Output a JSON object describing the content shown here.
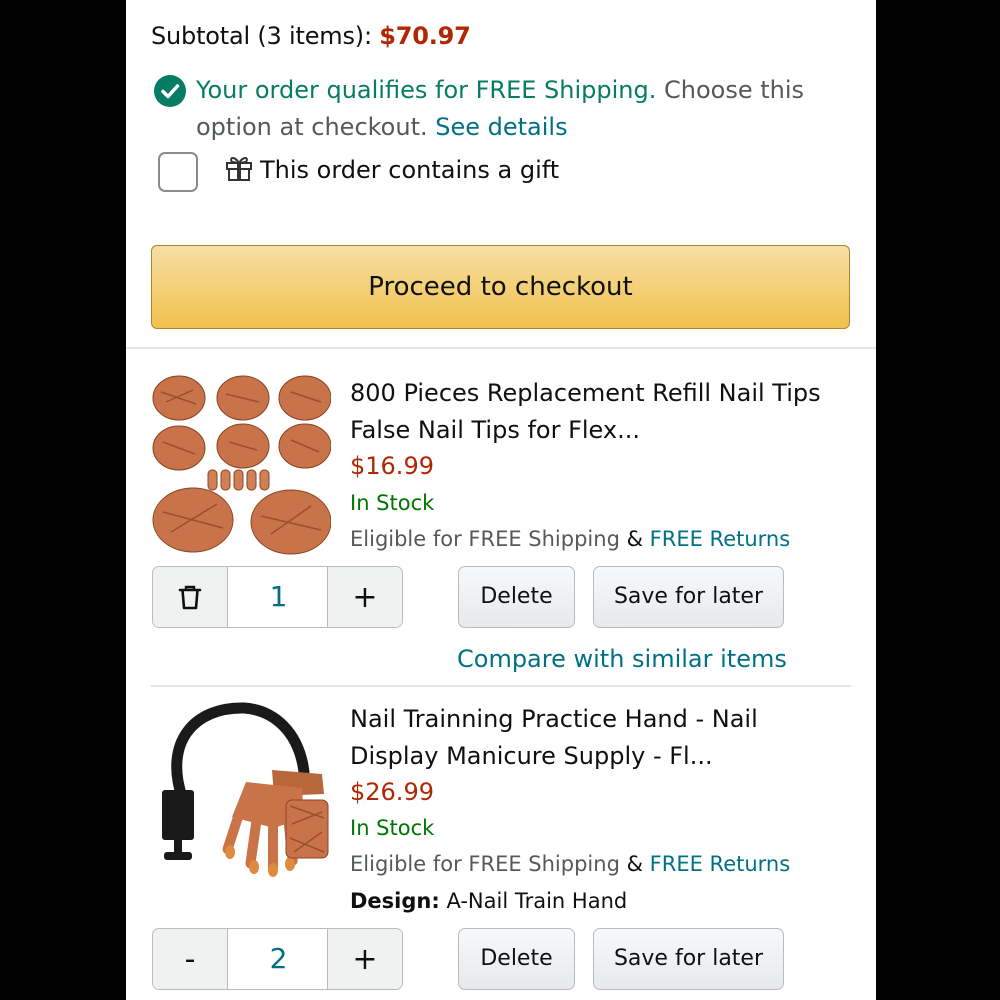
{
  "cart": {
    "subtotal_label": "Subtotal (3 items):",
    "subtotal_value": "$70.97",
    "free_shipping_green": "Your order qualifies for FREE Shipping.",
    "free_shipping_rest1": "Choose this",
    "free_shipping_rest2": "option at checkout.",
    "see_details": "See details",
    "gift_label": "This order contains a gift",
    "checkout_label": "Proceed to checkout"
  },
  "items": [
    {
      "title_line1": "800 Pieces Replacement Refill Nail Tips",
      "title_line2": "False Nail Tips for Flex...",
      "price": "$16.99",
      "stock": "In Stock",
      "shipping": "Eligible for FREE Shipping",
      "amp": "&",
      "returns": "FREE Returns",
      "quantity": "1",
      "left_control": "trash-icon",
      "plus": "+",
      "delete_label": "Delete",
      "save_label": "Save for later",
      "compare_label": "Compare with similar items"
    },
    {
      "title_line1": "Nail Trainning Practice Hand - Nail",
      "title_line2": "Display Manicure Supply - Fl...",
      "price": "$26.99",
      "stock": "In Stock",
      "shipping": "Eligible for FREE Shipping",
      "amp": "&",
      "returns": "FREE Returns",
      "design_label": "Design:",
      "design_value": "A-Nail Train Hand",
      "quantity": "2",
      "minus": "-",
      "plus": "+",
      "delete_label": "Delete",
      "save_label": "Save for later"
    }
  ],
  "colors": {
    "price": "#b12704",
    "link": "#007185",
    "in_stock": "#007600",
    "free_ship_green": "#067d62",
    "checkout_button": "#f0c14b"
  }
}
